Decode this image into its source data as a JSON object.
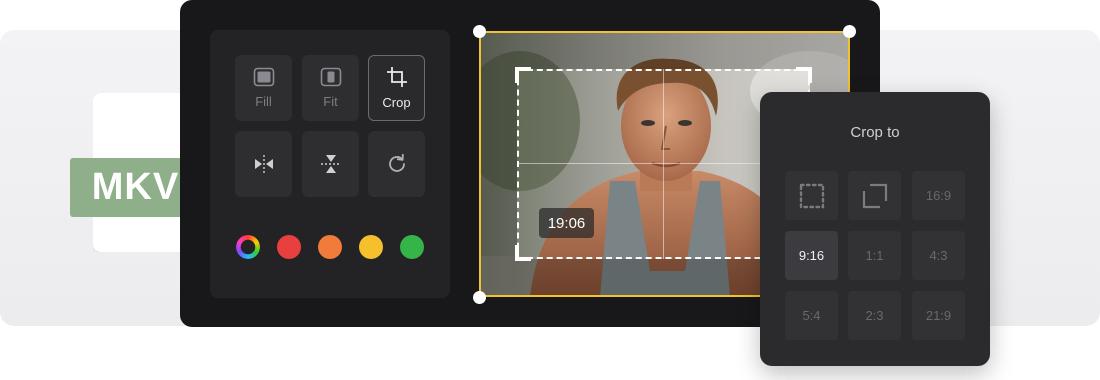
{
  "file": {
    "format_label": "MKV"
  },
  "toolbar": {
    "fill_label": "Fill",
    "fit_label": "Fit",
    "crop_label": "Crop"
  },
  "colors": {
    "swatches": [
      "#e8403f",
      "#f07b3a",
      "#f6c02d",
      "#35b44a"
    ],
    "frame_accent": "#f0c230"
  },
  "preview": {
    "timestamp": "19:06"
  },
  "crop_panel": {
    "title": "Crop to",
    "options": [
      "free-crop-icon",
      "original-icon",
      "16:9",
      "9:16",
      "1:1",
      "4:3",
      "5:4",
      "2:3",
      "21:9"
    ],
    "selected": "9:16"
  }
}
